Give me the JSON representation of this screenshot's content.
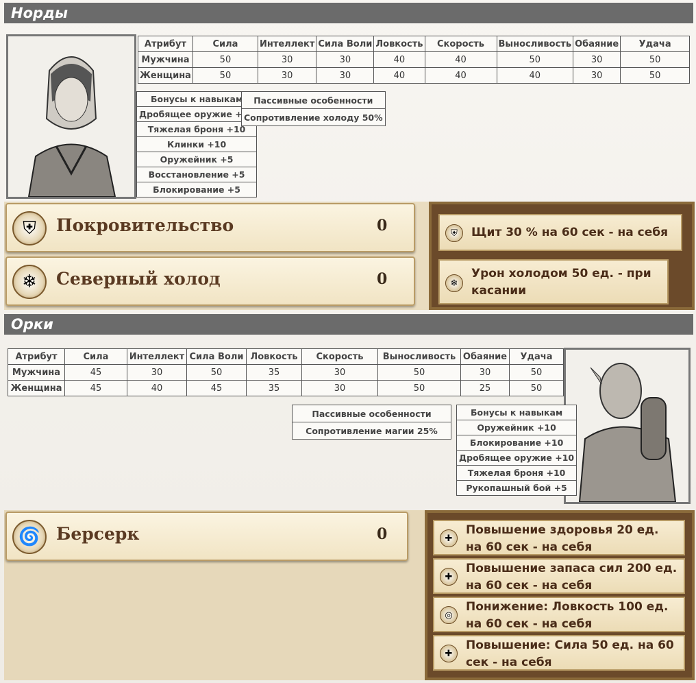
{
  "sections": [
    {
      "title": "Норды",
      "attr_table": {
        "headers": [
          "Атрибут",
          "Сила",
          "Интеллект",
          "Сила Воли",
          "Ловкость",
          "Скорость",
          "Выносливость",
          "Обаяние",
          "Удача"
        ],
        "rows": [
          [
            "Мужчина",
            "50",
            "30",
            "30",
            "40",
            "40",
            "50",
            "30",
            "50"
          ],
          [
            "Женщина",
            "50",
            "30",
            "30",
            "40",
            "40",
            "40",
            "30",
            "50"
          ]
        ]
      },
      "skills": {
        "title": "Бонусы к навыкам",
        "items": [
          "Дробящее оружие +10",
          "Тяжелая броня +10",
          "Клинки +10",
          "Оружейник +5",
          "Восстановление +5",
          "Блокирование +5"
        ]
      },
      "passives": {
        "title": "Пассивные особенности",
        "items": [
          "Сопротивление холоду 50%"
        ]
      },
      "spells": [
        {
          "name": "Покровительство",
          "cost": "0",
          "icon": "shield-spell-icon"
        },
        {
          "name": "Северный холод",
          "cost": "0",
          "icon": "frost-spell-icon"
        }
      ],
      "effects": [
        {
          "text": "Щит 30 % на 60 сек - на себя",
          "icon": "shield-effect-icon"
        },
        {
          "text": "Урон холодом 50 ед. - при касании",
          "icon": "frost-effect-icon"
        }
      ]
    },
    {
      "title": "Орки",
      "attr_table": {
        "headers": [
          "Атрибут",
          "Сила",
          "Интеллект",
          "Сила Воли",
          "Ловкость",
          "Скорость",
          "Выносливость",
          "Обаяние",
          "Удача"
        ],
        "rows": [
          [
            "Мужчина",
            "45",
            "30",
            "50",
            "35",
            "30",
            "50",
            "30",
            "50"
          ],
          [
            "Женщина",
            "45",
            "40",
            "45",
            "35",
            "30",
            "50",
            "25",
            "50"
          ]
        ]
      },
      "skills": {
        "title": "Бонусы к навыкам",
        "items": [
          "Оружейник +10",
          "Блокирование +10",
          "Дробящее оружие +10",
          "Тяжелая броня +10",
          "Рукопашный бой +5"
        ]
      },
      "passives": {
        "title": "Пассивные особенности",
        "items": [
          "Сопротивление магии 25%"
        ]
      },
      "spells": [
        {
          "name": "Берсерк",
          "cost": "0",
          "icon": "berserk-spell-icon"
        }
      ],
      "effects": [
        {
          "text": "Повышение здоровья 20 ед. на 60 сек - на себя",
          "icon": "health-effect-icon"
        },
        {
          "text": "Повышение запаса сил 200 ед. на 60 сек - на себя",
          "icon": "stamina-effect-icon"
        },
        {
          "text": "Понижение: Ловкость 100 ед. на 60 сек - на себя",
          "icon": "agility-effect-icon"
        },
        {
          "text": "Повышение: Сила 50 ед. на 60 сек - на себя",
          "icon": "strength-effect-icon"
        }
      ]
    }
  ]
}
